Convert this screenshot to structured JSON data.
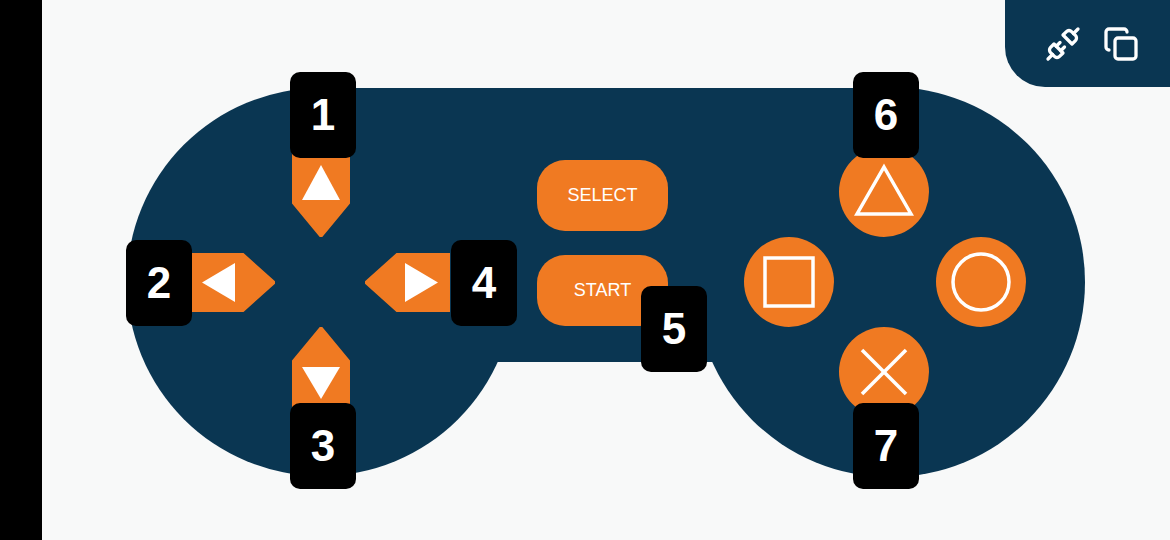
{
  "controller": {
    "dpad": [
      {
        "kind": "up",
        "badge": "1"
      },
      {
        "kind": "left",
        "badge": "2"
      },
      {
        "kind": "down",
        "badge": "3"
      },
      {
        "kind": "right",
        "badge": "4"
      }
    ],
    "center_buttons": [
      {
        "label": "SELECT",
        "badge": null
      },
      {
        "label": "START",
        "badge": "5"
      }
    ],
    "face_buttons": [
      {
        "kind": "triangle",
        "badge": "6"
      },
      {
        "kind": "square",
        "badge": null
      },
      {
        "kind": "circle",
        "badge": null
      },
      {
        "kind": "cross",
        "badge": "7"
      }
    ]
  }
}
